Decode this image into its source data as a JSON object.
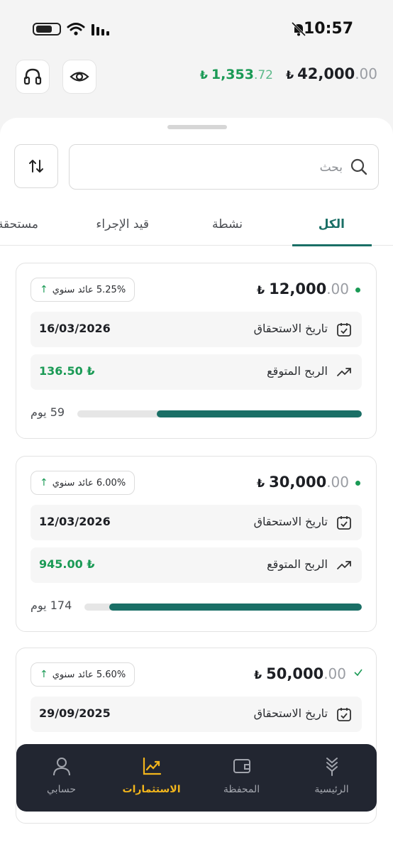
{
  "status_bar": {
    "time": "10:57"
  },
  "header": {
    "profit_currency": "₺",
    "profit_int": "1,353",
    "profit_dec": ".72",
    "total_currency": "₺",
    "total_int": "42,000",
    "total_dec": ".00"
  },
  "search": {
    "placeholder": "بحث"
  },
  "tabs": [
    {
      "label": "الكل",
      "active": true
    },
    {
      "label": "نشطة",
      "active": false
    },
    {
      "label": "قيد الإجراء",
      "active": false
    },
    {
      "label": "مستحقة",
      "active": false
    }
  ],
  "investments": [
    {
      "currency": "₺",
      "amount_int": "12,000",
      "amount_dec": ".00",
      "status": "active",
      "yield": "5.25% عائد سنوي",
      "maturity_label": "تاريخ الاستحقاق",
      "maturity_date": "16/03/2026",
      "profit_label": "الربح المتوقع",
      "profit_value": "136.50 ₺",
      "days_label": "59 يوم",
      "progress": 0.72
    },
    {
      "currency": "₺",
      "amount_int": "30,000",
      "amount_dec": ".00",
      "status": "active",
      "yield": "6.00% عائد سنوي",
      "maturity_label": "تاريخ الاستحقاق",
      "maturity_date": "12/03/2026",
      "profit_label": "الربح المتوقع",
      "profit_value": "945.00 ₺",
      "days_label": "174 يوم",
      "progress": 0.91
    },
    {
      "currency": "₺",
      "amount_int": "50,000",
      "amount_dec": ".00",
      "status": "completed",
      "yield": "5.60% عائد سنوي",
      "maturity_label": "تاريخ الاستحقاق",
      "maturity_date": "29/09/2025"
    }
  ],
  "nav": [
    {
      "label": "الرئيسية",
      "icon": "home-logo-icon",
      "active": false
    },
    {
      "label": "المحفظة",
      "icon": "wallet-icon",
      "active": false
    },
    {
      "label": "الاستثمارات",
      "icon": "chart-up-icon",
      "active": true
    },
    {
      "label": "حسابي",
      "icon": "user-icon",
      "active": false
    }
  ],
  "colors": {
    "accent": "#1a6f66",
    "profit_green": "#1a9a55",
    "nav_active": "#f2b51c",
    "nav_bg": "#222631"
  }
}
